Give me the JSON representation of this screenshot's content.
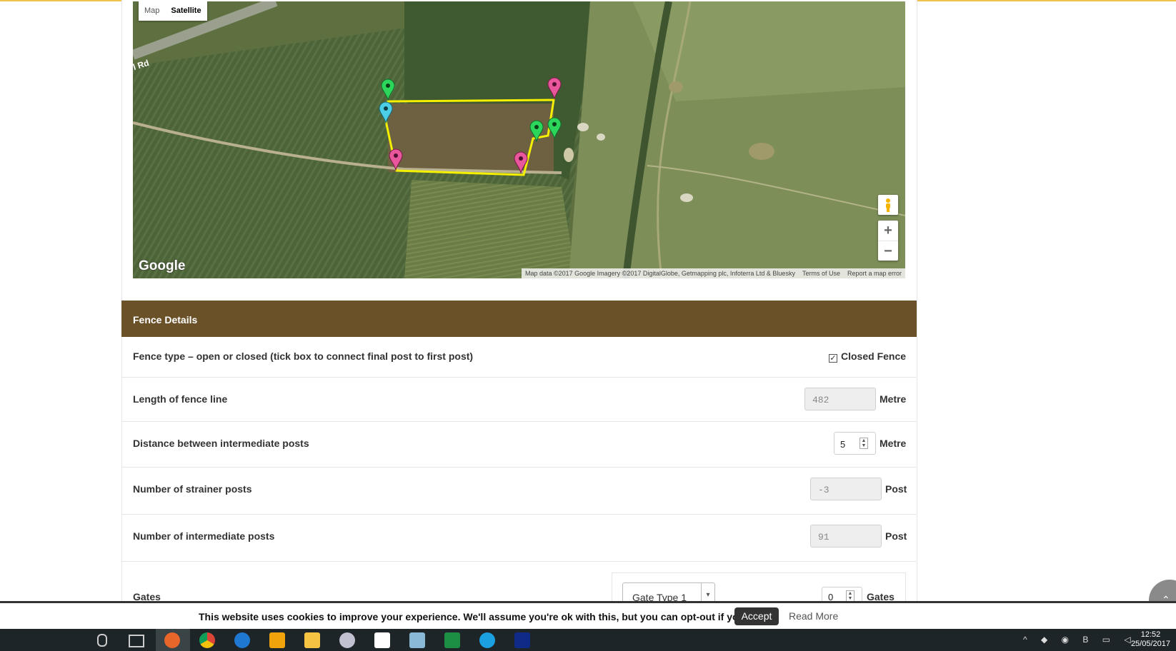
{
  "map": {
    "type_map": "Map",
    "type_satellite": "Satellite",
    "road_label": "l Rd",
    "logo": "Google",
    "attribution": "Map data ©2017 Google Imagery ©2017 DigitalGlobe, Getmapping plc, Infoterra Ltd & Bluesky",
    "terms": "Terms of Use",
    "report": "Report a map error",
    "zoom_in": "+",
    "zoom_out": "−",
    "boundary_color": "#f5f000",
    "marker_colors": {
      "green": "#2bd65a",
      "pink": "#e8569b",
      "cyan": "#4ccfe6"
    }
  },
  "fence": {
    "header": "Fence Details",
    "rows": [
      {
        "label": "Fence type – open or closed (tick box to connect final post to first post)",
        "checkbox_label": "Closed Fence",
        "checked": true
      },
      {
        "label": "Length of fence line",
        "value": "482",
        "unit": "Metre"
      },
      {
        "label": "Distance between intermediate posts",
        "value": "5",
        "unit": "Metre"
      },
      {
        "label": "Number of strainer posts",
        "value": "-3",
        "unit": "Post"
      },
      {
        "label": "Number of intermediate posts",
        "value": "91",
        "unit": "Post"
      }
    ],
    "gates": {
      "label": "Gates",
      "select": "Gate Type 1",
      "count": "0",
      "unit": "Gates"
    }
  },
  "cookie": {
    "message": "This website uses cookies to improve your experience. We'll assume you're ok with this, but you can opt-out if you wish.",
    "accept": "Accept",
    "read_more": "Read More"
  },
  "taskbar": {
    "apps": [
      "microphone-icon",
      "task-view-icon",
      "firefox-icon",
      "chrome-icon",
      "edge-icon",
      "outlook-icon",
      "file-explorer-icon",
      "snipping-tool-icon",
      "store-icon",
      "notepad-icon",
      "excel-icon",
      "skype-icon",
      "stocks-icon"
    ],
    "time": "12:52",
    "date": "25/05/2017"
  },
  "colors": {
    "header_bg": "#6b5128",
    "accent_top": "#f2c24f"
  }
}
